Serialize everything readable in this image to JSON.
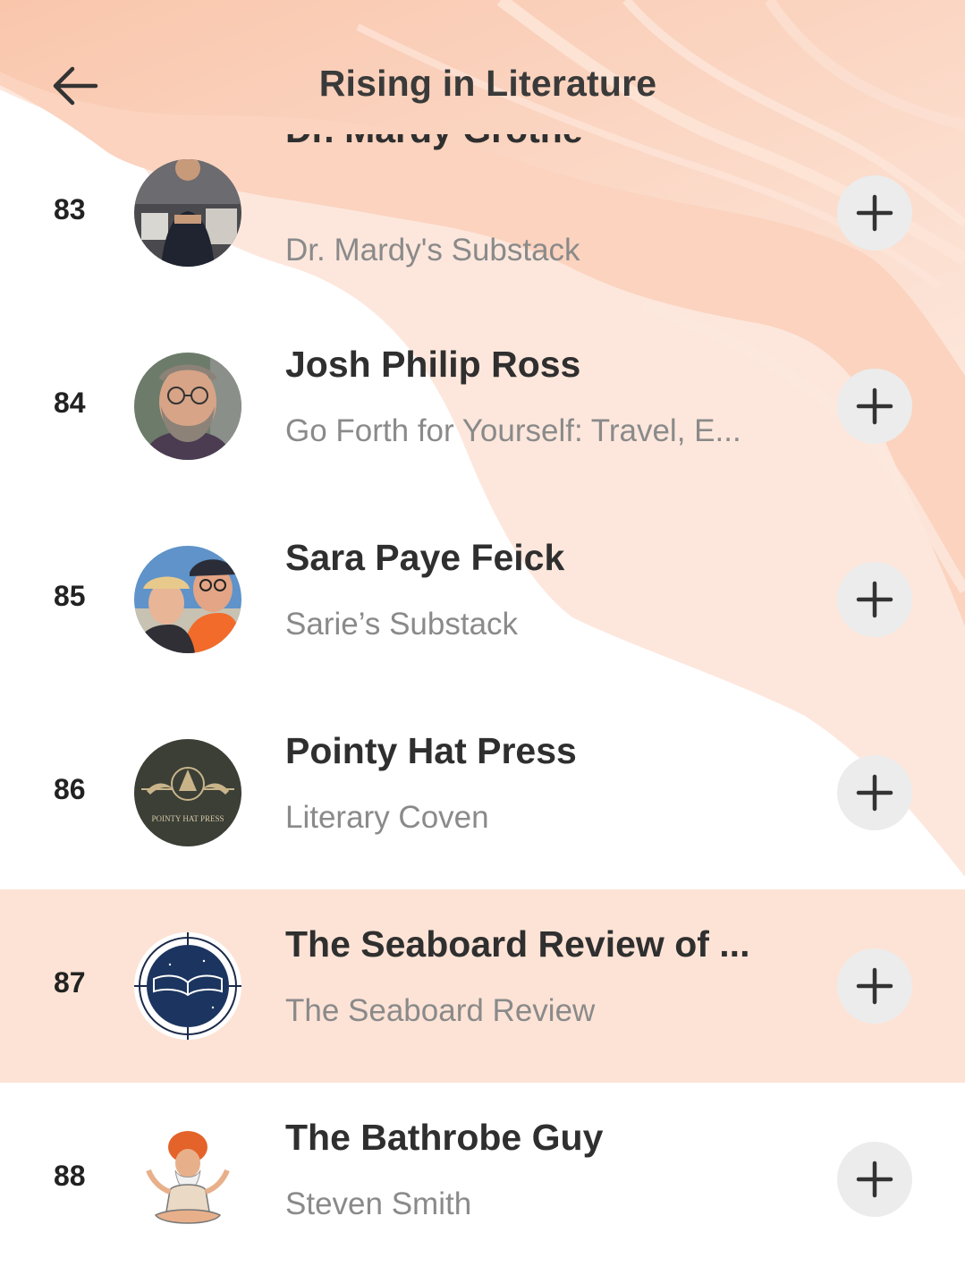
{
  "header": {
    "title": "Rising in Literature",
    "back_icon": "arrow-left-icon"
  },
  "list": [
    {
      "rank": "83",
      "name": "Dr. Mardy Grothe",
      "publication": "Dr. Mardy's Substack",
      "action_icon": "plus-icon",
      "highlighted": false
    },
    {
      "rank": "84",
      "name": "Josh Philip Ross",
      "publication": "Go Forth for Yourself: Travel, E...",
      "action_icon": "plus-icon",
      "highlighted": false
    },
    {
      "rank": "85",
      "name": "Sara Paye Feick",
      "publication": "Sarie’s Substack",
      "action_icon": "plus-icon",
      "highlighted": false
    },
    {
      "rank": "86",
      "name": "Pointy Hat Press",
      "publication": "Literary Coven",
      "avatar_text": "POINTY HAT PRESS",
      "action_icon": "plus-icon",
      "highlighted": false
    },
    {
      "rank": "87",
      "name": "The Seaboard Review of ...",
      "publication": "The Seaboard Review",
      "action_icon": "plus-icon",
      "highlighted": true
    },
    {
      "rank": "88",
      "name": "The Bathrobe Guy",
      "publication": "Steven Smith",
      "action_icon": "plus-icon",
      "highlighted": false
    }
  ],
  "colors": {
    "accent": "#f7a989",
    "highlight_row": "#fde3d6",
    "button_bg": "#ececec",
    "subtitle_text": "#8a8a8a"
  }
}
